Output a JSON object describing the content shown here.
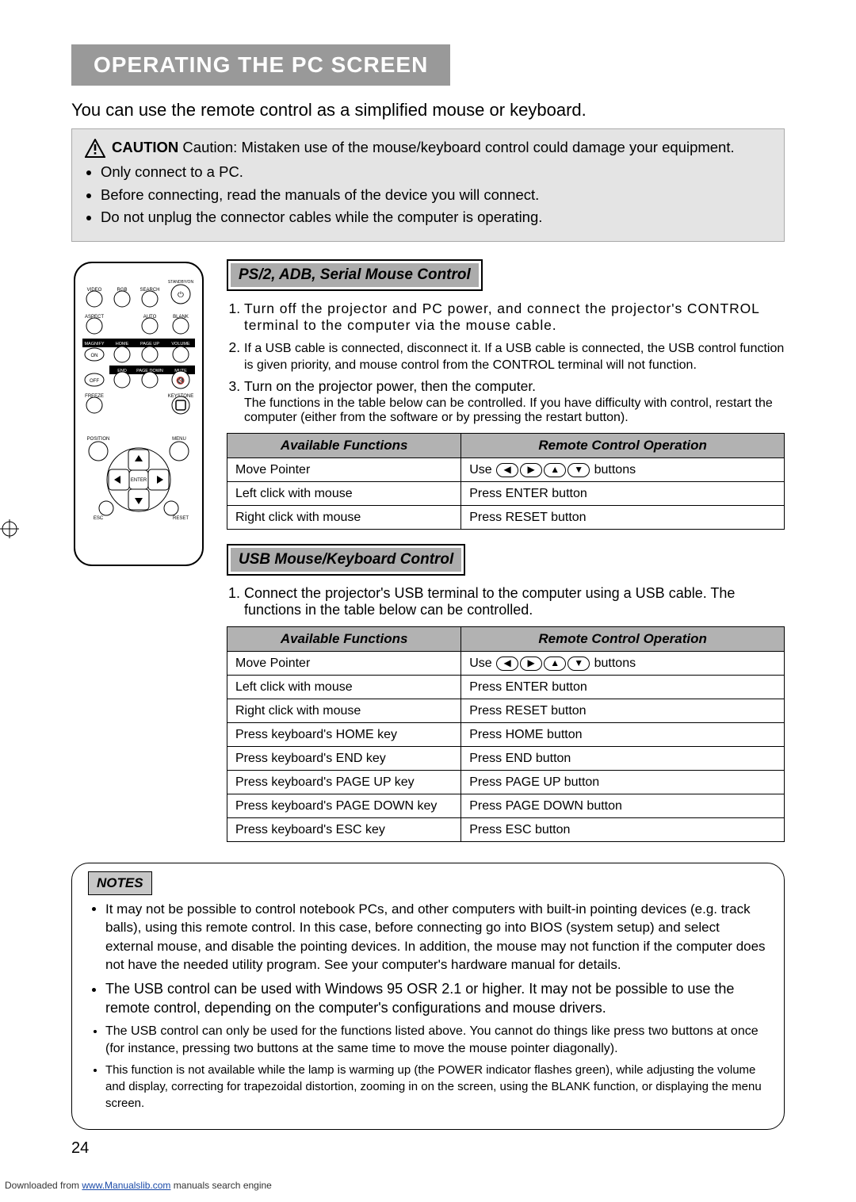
{
  "page": {
    "title": "OPERATING THE PC SCREEN",
    "intro": "You can use the remote control as a simplified mouse or keyboard.",
    "page_number": "24"
  },
  "caution": {
    "label": "CAUTION",
    "text": "Caution: Mistaken use of the mouse/keyboard control could damage your equipment.",
    "bullets": [
      "Only connect to a PC.",
      "Before connecting, read the manuals of the device you will connect.",
      "Do not unplug the connector cables while the computer is operating."
    ]
  },
  "remote": {
    "row1": [
      "VIDEO",
      "RGB",
      "SEARCH",
      "STANDBY/ON"
    ],
    "row2": [
      "ASPECT",
      "AUTO",
      "BLANK"
    ],
    "row3": [
      "MAGNIFY",
      "HOME",
      "PAGE UP",
      "VOLUME"
    ],
    "row3b": [
      "ON"
    ],
    "row4a": [
      "END",
      "PAGE DOWN",
      "MUTE"
    ],
    "row4b": [
      "OFF"
    ],
    "row5": [
      "FREEZE",
      "KEYSTONE"
    ],
    "row6": [
      "POSITION",
      "MENU"
    ],
    "dpad": {
      "center": "ENTER",
      "esc": "ESC",
      "reset": "RESET"
    }
  },
  "section1": {
    "heading": "PS/2, ADB, Serial Mouse Control",
    "steps": [
      {
        "main": "Turn off the projector and PC power, and connect the projector's CONTROL terminal to the computer via the mouse cable."
      },
      {
        "main": "If a USB cable is connected, disconnect it. If a USB cable is connected, the USB control function is given priority, and mouse control from the CONTROL terminal will not function."
      },
      {
        "main": "Turn on the projector power, then the computer.",
        "sub": "The functions in the table below can be controlled. If you have difficulty with control, restart the computer (either from the software or by pressing the restart button)."
      }
    ],
    "table": {
      "head": [
        "Available Functions",
        "Remote Control Operation"
      ],
      "rows": [
        [
          "Move Pointer",
          "USE_ARROWS"
        ],
        [
          "Left click with mouse",
          "Press ENTER button"
        ],
        [
          "Right click with mouse",
          "Press RESET button"
        ]
      ],
      "arrow_prefix": "Use ",
      "arrow_suffix": " buttons"
    }
  },
  "section2": {
    "heading": "USB Mouse/Keyboard Control",
    "steps": [
      {
        "main": "Connect the projector's USB terminal to the computer using a USB cable. The functions in the table below can be controlled."
      }
    ],
    "table": {
      "head": [
        "Available Functions",
        "Remote Control Operation"
      ],
      "rows": [
        [
          "Move Pointer",
          "USE_ARROWS"
        ],
        [
          "Left click with mouse",
          "Press ENTER button"
        ],
        [
          "Right click with mouse",
          "Press RESET button"
        ],
        [
          "Press keyboard's HOME key",
          "Press HOME button"
        ],
        [
          "Press keyboard's END key",
          "Press END button"
        ],
        [
          "Press keyboard's PAGE UP key",
          "Press PAGE UP button"
        ],
        [
          "Press keyboard's PAGE DOWN key",
          "Press PAGE DOWN button"
        ],
        [
          "Press keyboard's ESC key",
          "Press ESC button"
        ]
      ],
      "arrow_prefix": "Use ",
      "arrow_suffix": " buttons"
    }
  },
  "notes": {
    "label": "NOTES",
    "items": [
      "It may not be possible to control notebook PCs, and other computers with built-in pointing devices (e.g. track balls), using this remote control. In this case, before connecting go into BIOS (system setup) and select external mouse, and disable the pointing devices. In addition, the mouse may not function if the computer does not have the needed utility program. See your computer's hardware manual for details.",
      "The USB control can be used with Windows 95 OSR 2.1 or higher. It may not be possible to use the remote control, depending on the computer's configurations and mouse drivers.",
      "The USB control can only be used for the functions listed above. You cannot do things like press two buttons at once (for instance, pressing two buttons at the same time to move the mouse pointer diagonally).",
      "This function is not available while the lamp is warming up (the POWER indicator flashes green), while adjusting the volume and display, correcting for trapezoidal distortion, zooming in on the screen, using the BLANK function, or displaying the menu screen."
    ]
  },
  "footer": {
    "prefix": "Downloaded from ",
    "link": "www.Manualslib.com",
    "suffix": " manuals search engine"
  }
}
